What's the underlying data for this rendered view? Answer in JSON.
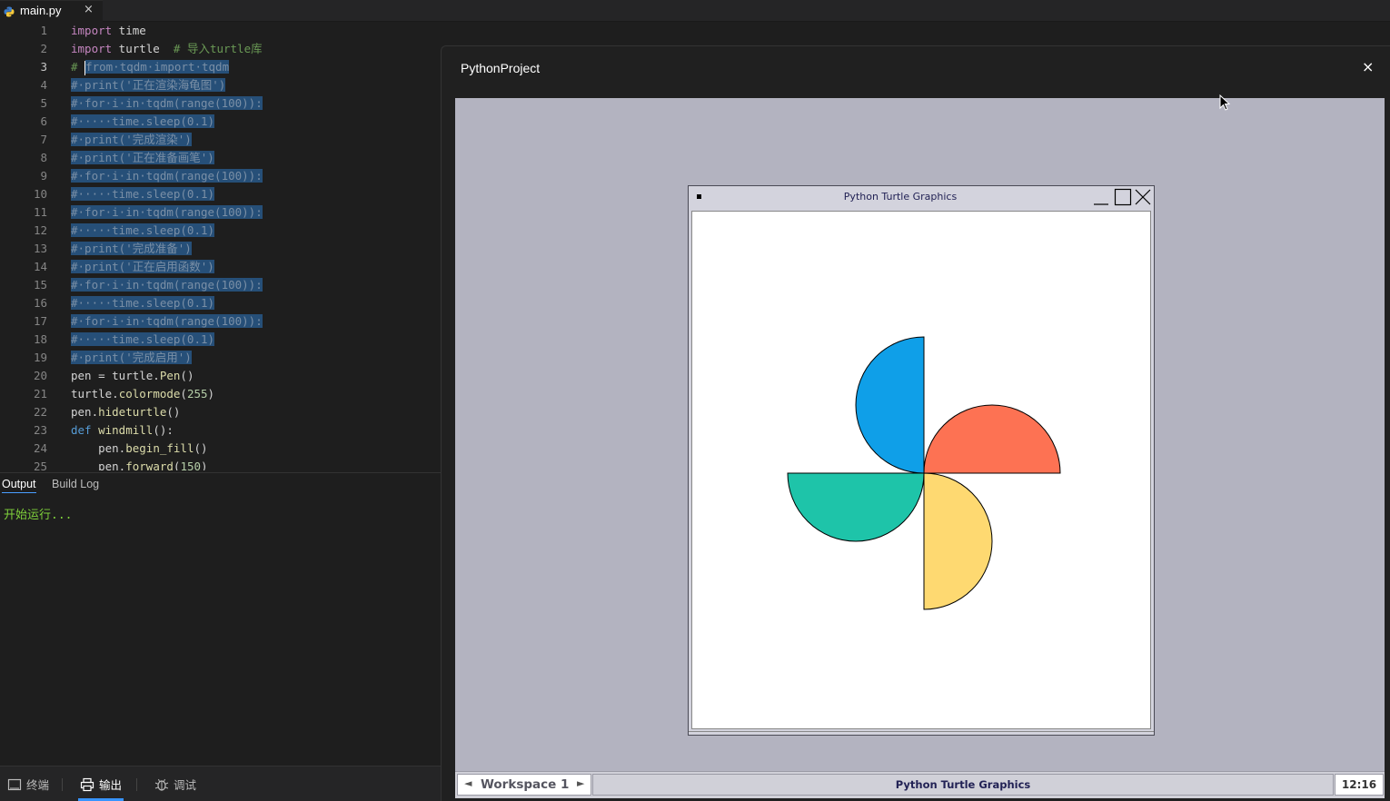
{
  "editor": {
    "tab_label": "main.py",
    "tab_close": "×",
    "active_line": 3,
    "lines": [
      {
        "n": "1",
        "tokens": [
          [
            "kw",
            "import"
          ],
          [
            "",
            " time"
          ]
        ]
      },
      {
        "n": "2",
        "tokens": [
          [
            "kw",
            "import"
          ],
          [
            "",
            " turtle  "
          ],
          [
            "cm",
            "# 导入turtle库"
          ]
        ]
      },
      {
        "n": "3",
        "selected": true,
        "prefix": "# ",
        "tokens": [
          [
            "",
            "from·tqdm·import·tqdm"
          ]
        ]
      },
      {
        "n": "4",
        "selected": true,
        "tokens": [
          [
            "",
            "#·print('正在渲染海龟图')"
          ]
        ]
      },
      {
        "n": "5",
        "selected": true,
        "tokens": [
          [
            "",
            "#·for·i·in·tqdm(range(100)):"
          ]
        ]
      },
      {
        "n": "6",
        "selected": true,
        "tokens": [
          [
            "",
            "#·····time.sleep(0.1)"
          ]
        ]
      },
      {
        "n": "7",
        "selected": true,
        "tokens": [
          [
            "",
            "#·print('完成渲染')"
          ]
        ]
      },
      {
        "n": "8",
        "selected": true,
        "tokens": [
          [
            "",
            "#·print('正在准备画笔')"
          ]
        ]
      },
      {
        "n": "9",
        "selected": true,
        "tokens": [
          [
            "",
            "#·for·i·in·tqdm(range(100)):"
          ]
        ]
      },
      {
        "n": "10",
        "selected": true,
        "tokens": [
          [
            "",
            "#·····time.sleep(0.1)"
          ]
        ]
      },
      {
        "n": "11",
        "selected": true,
        "tokens": [
          [
            "",
            "#·for·i·in·tqdm(range(100)):"
          ]
        ]
      },
      {
        "n": "12",
        "selected": true,
        "tokens": [
          [
            "",
            "#·····time.sleep(0.1)"
          ]
        ]
      },
      {
        "n": "13",
        "selected": true,
        "tokens": [
          [
            "",
            "#·print('完成准备')"
          ]
        ]
      },
      {
        "n": "14",
        "selected": true,
        "tokens": [
          [
            "",
            "#·print('正在启用函数')"
          ]
        ]
      },
      {
        "n": "15",
        "selected": true,
        "tokens": [
          [
            "",
            "#·for·i·in·tqdm(range(100)):"
          ]
        ]
      },
      {
        "n": "16",
        "selected": true,
        "tokens": [
          [
            "",
            "#·····time.sleep(0.1)"
          ]
        ]
      },
      {
        "n": "17",
        "selected": true,
        "tokens": [
          [
            "",
            "#·for·i·in·tqdm(range(100)):"
          ]
        ]
      },
      {
        "n": "18",
        "selected": true,
        "tokens": [
          [
            "",
            "#·····time.sleep(0.1)"
          ]
        ]
      },
      {
        "n": "19",
        "selected": true,
        "tokens": [
          [
            "",
            "#·print('完成启用')"
          ]
        ]
      },
      {
        "n": "20",
        "tokens": [
          [
            "",
            "pen = turtle."
          ],
          [
            "fn",
            "Pen"
          ],
          [
            "",
            "()"
          ]
        ]
      },
      {
        "n": "21",
        "tokens": [
          [
            "",
            "turtle."
          ],
          [
            "fn",
            "colormode"
          ],
          [
            "",
            "("
          ],
          [
            "num",
            "255"
          ],
          [
            "",
            ")"
          ]
        ]
      },
      {
        "n": "22",
        "tokens": [
          [
            "",
            "pen."
          ],
          [
            "fn",
            "hideturtle"
          ],
          [
            "",
            "()"
          ]
        ]
      },
      {
        "n": "23",
        "tokens": [
          [
            "def",
            "def"
          ],
          [
            "",
            " "
          ],
          [
            "fn",
            "windmill"
          ],
          [
            "",
            "():"
          ]
        ]
      },
      {
        "n": "24",
        "tokens": [
          [
            "",
            "    pen."
          ],
          [
            "fn",
            "begin_fill"
          ],
          [
            "",
            "()"
          ]
        ]
      },
      {
        "n": "25",
        "tokens": [
          [
            "",
            "    pen."
          ],
          [
            "fn",
            "forward"
          ],
          [
            "",
            "("
          ],
          [
            "num",
            "150"
          ],
          [
            "",
            ")"
          ]
        ]
      }
    ]
  },
  "panel": {
    "tab_output": "Output",
    "tab_build_log": "Build Log",
    "output_text": "开始运行..."
  },
  "bottom_bar": {
    "terminal_label": "终端",
    "output_label": "输出",
    "debug_label": "调试"
  },
  "project_window": {
    "title": "PythonProject",
    "close": "×"
  },
  "turtle_window": {
    "title": "Python Turtle Graphics",
    "blades": [
      {
        "name": "blue-blade",
        "color": "#0f9fe8"
      },
      {
        "name": "red-blade",
        "color": "#fd7253"
      },
      {
        "name": "yellow-blade",
        "color": "#fed971"
      },
      {
        "name": "green-blade",
        "color": "#1ec4a9"
      }
    ]
  },
  "taskbar": {
    "workspace_label": "Workspace 1",
    "prev_arrow": "◄",
    "next_arrow": "►",
    "task_label": "Python Turtle Graphics",
    "clock": "12:16"
  }
}
